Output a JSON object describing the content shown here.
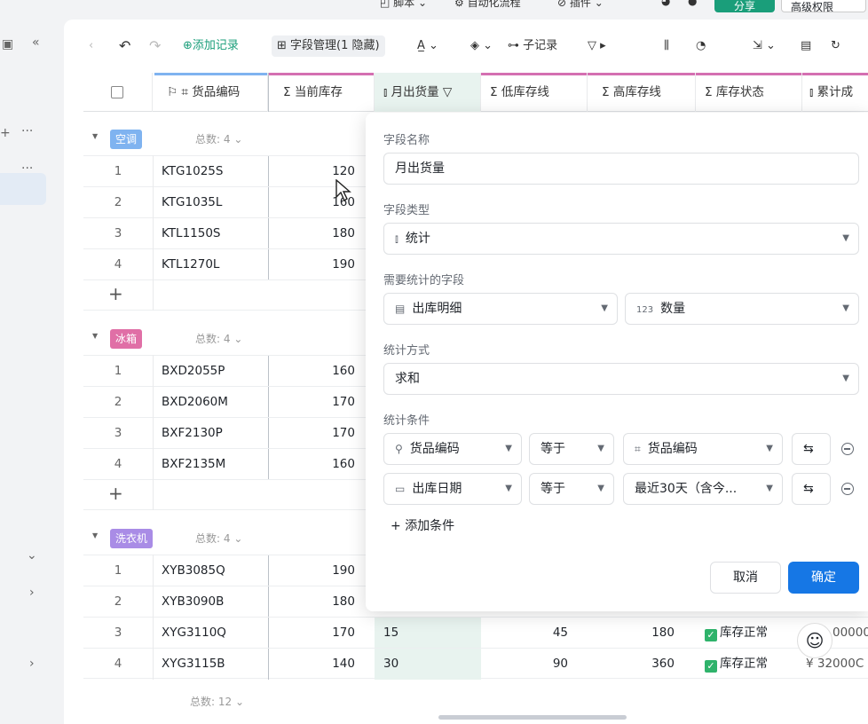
{
  "topbar": {
    "items": [
      "脚本",
      "自动化流程",
      "插件"
    ],
    "share": "分享",
    "advanced": "高级权限"
  },
  "toolbar": {
    "add_record": "添加记录",
    "field_manage": "字段管理(1 隐藏)",
    "sub_record": "子记录"
  },
  "columns": {
    "code": "货品编码",
    "stock": "当前库存",
    "out": "月出货量",
    "low": "低库存线",
    "high": "高库存线",
    "status": "库存状态",
    "cum": "累计成"
  },
  "groups": [
    {
      "name": "空调",
      "color": "#7fb3f0",
      "count": "总数: 4",
      "rows": [
        {
          "n": "1",
          "code": "KTG1025S",
          "stock": "120"
        },
        {
          "n": "2",
          "code": "KTG1035L",
          "stock": "160"
        },
        {
          "n": "3",
          "code": "KTL1150S",
          "stock": "180"
        },
        {
          "n": "4",
          "code": "KTL1270L",
          "stock": "190"
        }
      ]
    },
    {
      "name": "冰箱",
      "color": "#e06fa6",
      "count": "总数: 4",
      "rows": [
        {
          "n": "1",
          "code": "BXD2055P",
          "stock": "160"
        },
        {
          "n": "2",
          "code": "BXD2060M",
          "stock": "170"
        },
        {
          "n": "3",
          "code": "BXF2130P",
          "stock": "170"
        },
        {
          "n": "4",
          "code": "BXF2135M",
          "stock": "160"
        }
      ]
    },
    {
      "name": "洗衣机",
      "color": "#a98ce6",
      "count": "总数: 4",
      "rows": [
        {
          "n": "1",
          "code": "XYB3085Q",
          "stock": "190"
        },
        {
          "n": "2",
          "code": "XYB3090B",
          "stock": "180"
        },
        {
          "n": "3",
          "code": "XYG3110Q",
          "stock": "170",
          "out": "15",
          "low": "45",
          "high": "180",
          "status": "库存正常",
          "cum": "00000"
        },
        {
          "n": "4",
          "code": "XYG3115B",
          "stock": "140",
          "out": "30",
          "low": "90",
          "high": "360",
          "status": "库存正常",
          "cum": "¥ 32000C"
        }
      ]
    }
  ],
  "total": "总数: 12",
  "panel": {
    "name_label": "字段名称",
    "name_value": "月出货量",
    "type_label": "字段类型",
    "type_value": "统计",
    "stat_field_label": "需要统计的字段",
    "stat_table": "出库明细",
    "stat_field": "数量",
    "method_label": "统计方式",
    "method_value": "求和",
    "cond_label": "统计条件",
    "cond1": {
      "field": "货品编码",
      "op": "等于",
      "value": "货品编码"
    },
    "cond2": {
      "field": "出库日期",
      "op": "等于",
      "value": "最近30天（含今..."
    },
    "add_condition": "添加条件",
    "cancel": "取消",
    "confirm": "确定"
  }
}
